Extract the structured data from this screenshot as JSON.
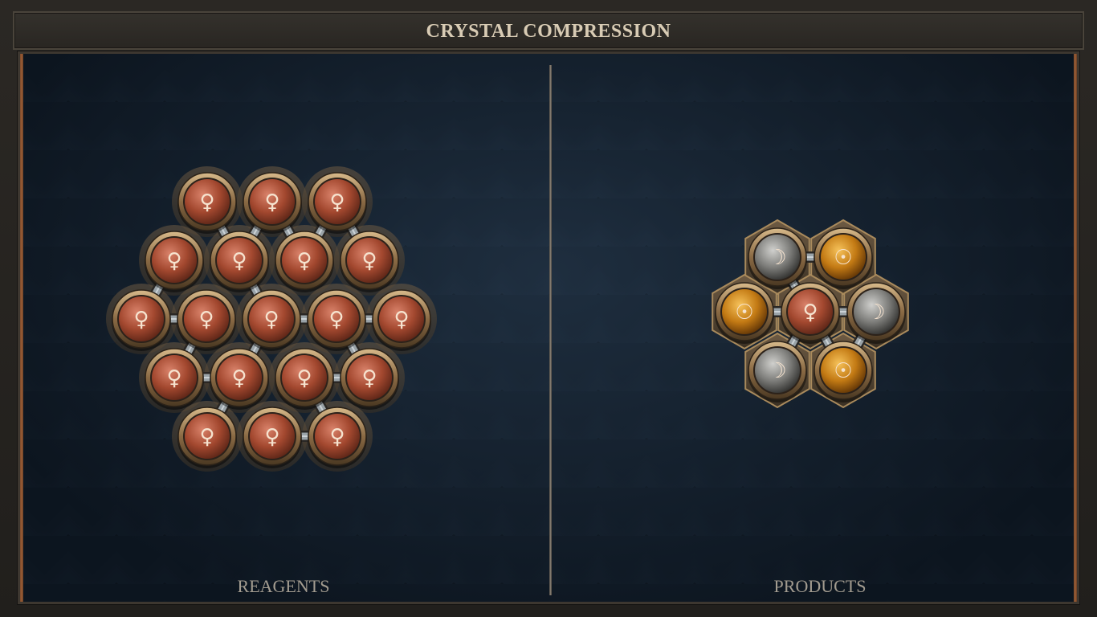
{
  "title": "CRYSTAL COMPRESSION",
  "reagents_label": "REAGENTS",
  "products_label": "PRODUCTS",
  "colors": {
    "copper": "#b0553b",
    "quicksilver": "#8a8a88",
    "gold": "#d18b1e",
    "bond": "#9aa3a8",
    "glyph": "#f6e3cf"
  },
  "icons": {
    "copper": "venus-symbol-icon",
    "quicksilver": "crescent-moon-icon",
    "gold": "sun-symbol-icon"
  },
  "reagents": {
    "atom_count": 19,
    "element": "copper",
    "symbol": "♀"
  },
  "products": {
    "atoms": [
      {
        "element": "quicksilver",
        "symbol": "☽"
      },
      {
        "element": "gold",
        "symbol": "☉"
      },
      {
        "element": "gold",
        "symbol": "☉"
      },
      {
        "element": "copper",
        "symbol": "♀"
      },
      {
        "element": "quicksilver",
        "symbol": "☽"
      },
      {
        "element": "quicksilver",
        "symbol": "☽"
      },
      {
        "element": "gold",
        "symbol": "☉"
      }
    ]
  }
}
